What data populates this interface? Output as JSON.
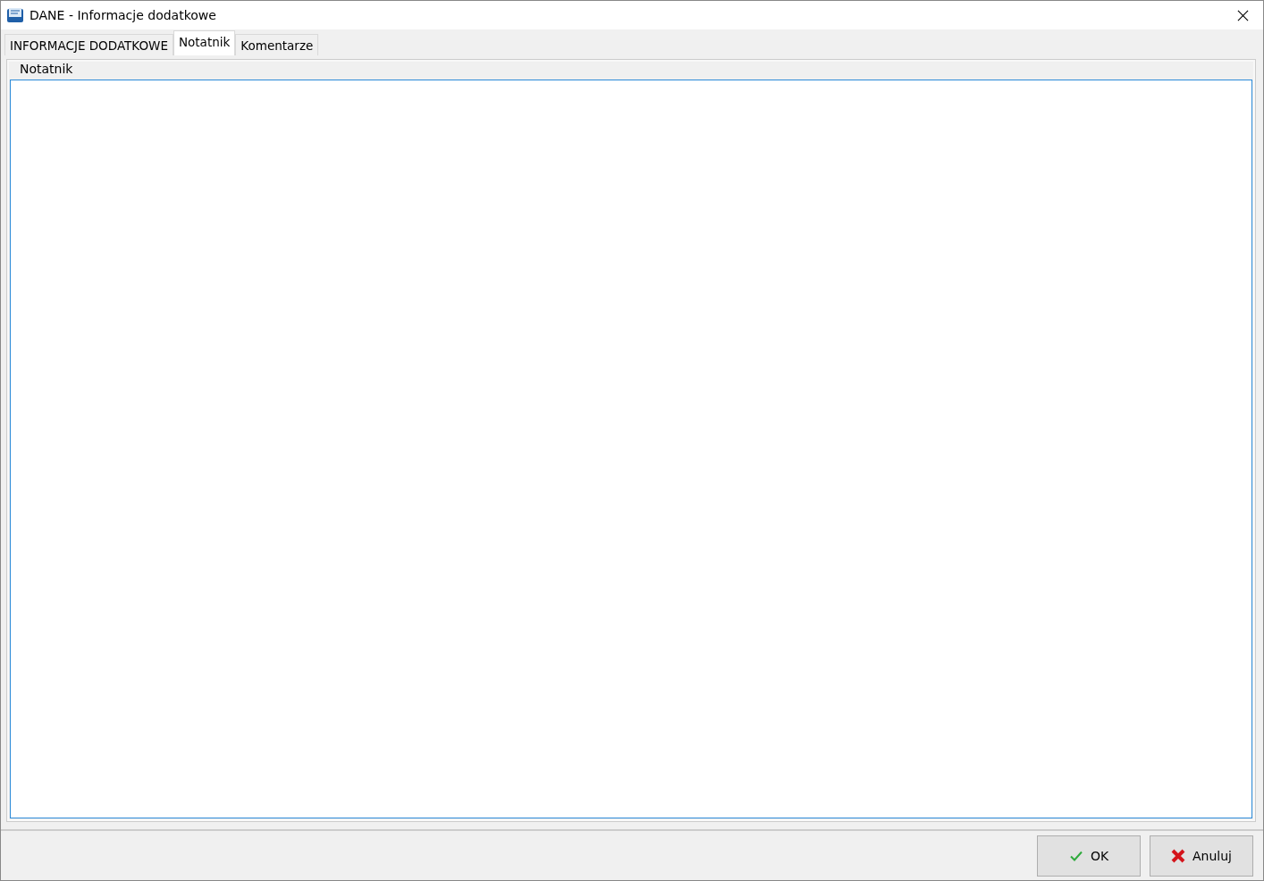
{
  "window": {
    "title": "DANE - Informacje dodatkowe"
  },
  "tabs": [
    {
      "label": "INFORMACJE DODATKOWE",
      "selected": false
    },
    {
      "label": "Notatnik",
      "selected": true
    },
    {
      "label": "Komentarze",
      "selected": false
    }
  ],
  "group": {
    "title": "Notatnik"
  },
  "buttons": [
    {
      "label": "OK",
      "kind": "ok"
    },
    {
      "label": "Anuluj",
      "kind": "cancel"
    }
  ]
}
